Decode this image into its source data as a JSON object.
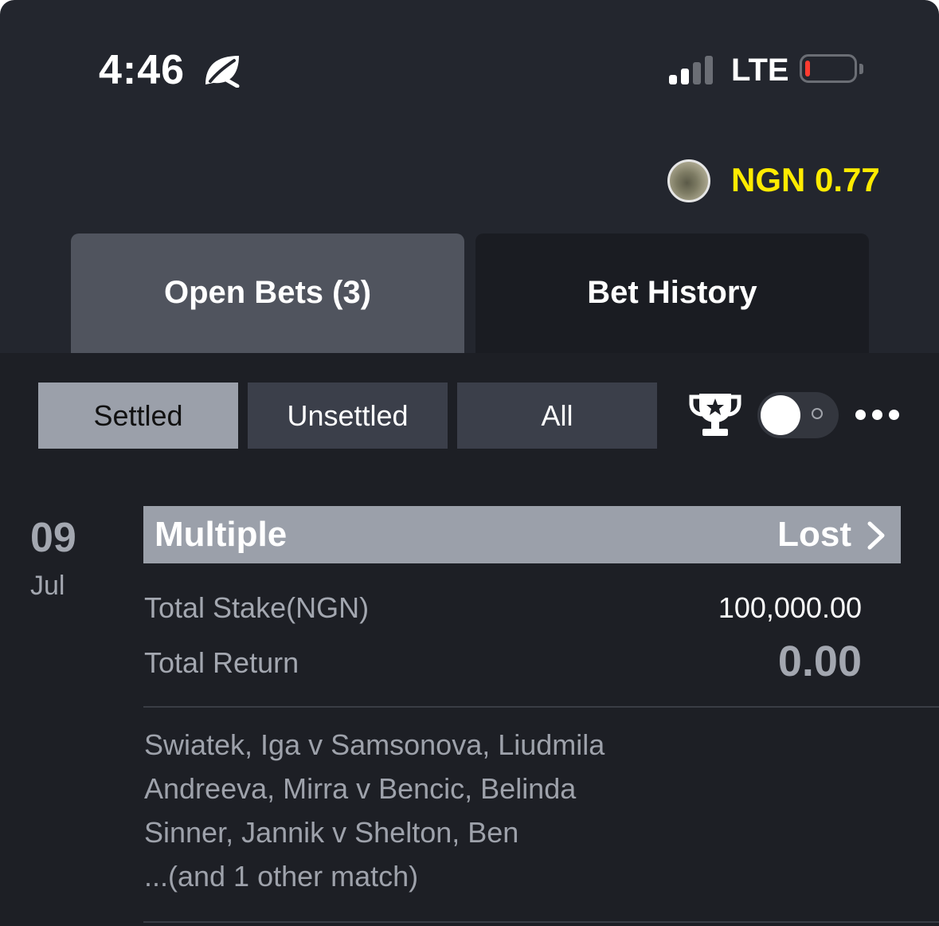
{
  "status_bar": {
    "time": "4:46",
    "network": "LTE",
    "icons": [
      "leaf-icon",
      "signal-icon",
      "battery-icon"
    ],
    "battery_level": 0.1
  },
  "account": {
    "balance": "NGN 0.77"
  },
  "tabs": [
    {
      "label": "Open Bets (3)",
      "active": true
    },
    {
      "label": "Bet History",
      "active": false
    }
  ],
  "filters": [
    {
      "label": "Settled",
      "active": true
    },
    {
      "label": "Unsettled",
      "active": false
    },
    {
      "label": "All",
      "active": false
    }
  ],
  "toolbar": {
    "icons": [
      "trophy-icon",
      "toggle-switch",
      "more-icon"
    ],
    "toggle_on": false
  },
  "bet": {
    "day": "09",
    "month": "Jul",
    "type": "Multiple",
    "status": "Lost",
    "stake_label": "Total Stake(NGN)",
    "stake_value": "100,000.00",
    "return_label": "Total Return",
    "return_value": "0.00",
    "matches": [
      "Swiatek, Iga v Samsonova, Liudmila",
      "Andreeva, Mirra v Bencic, Belinda",
      "Sinner, Jannik v Shelton, Ben",
      "...(and 1 other match)"
    ]
  },
  "colors": {
    "background": "#23262e",
    "balance": "#ffeb00",
    "active_chip": "#9ba0aa",
    "inactive_chip": "#3b3f4a",
    "battery_low": "#ff3b30"
  }
}
